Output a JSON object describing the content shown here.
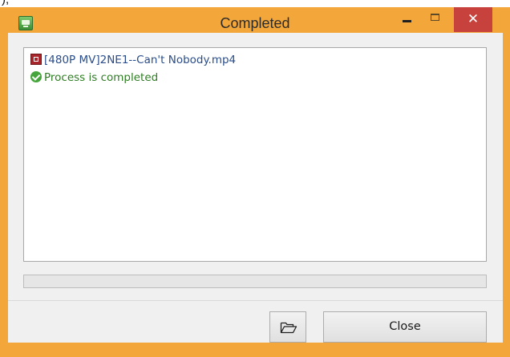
{
  "window": {
    "title": "Completed",
    "icon": "app-icon",
    "controls": {
      "minimize_icon": "minimize-icon",
      "maximize_icon": "maximize-icon",
      "close_glyph": "✕"
    }
  },
  "log": {
    "items": [
      {
        "icon": "video-file-icon",
        "text": "[480P MV]2NE1--Can't Nobody.mp4",
        "color": "#2a4d8a"
      },
      {
        "icon": "check-circle-icon",
        "text": "Process is completed",
        "color": "#2e7d22"
      }
    ]
  },
  "progress": {
    "fraction": 0.0
  },
  "buttons": {
    "open_folder_icon": "open-folder-icon",
    "close_label": "Close"
  },
  "colors": {
    "titlebar": "#f3a73a",
    "close_button": "#c7423c",
    "dialog_background": "#f0f0f0"
  }
}
